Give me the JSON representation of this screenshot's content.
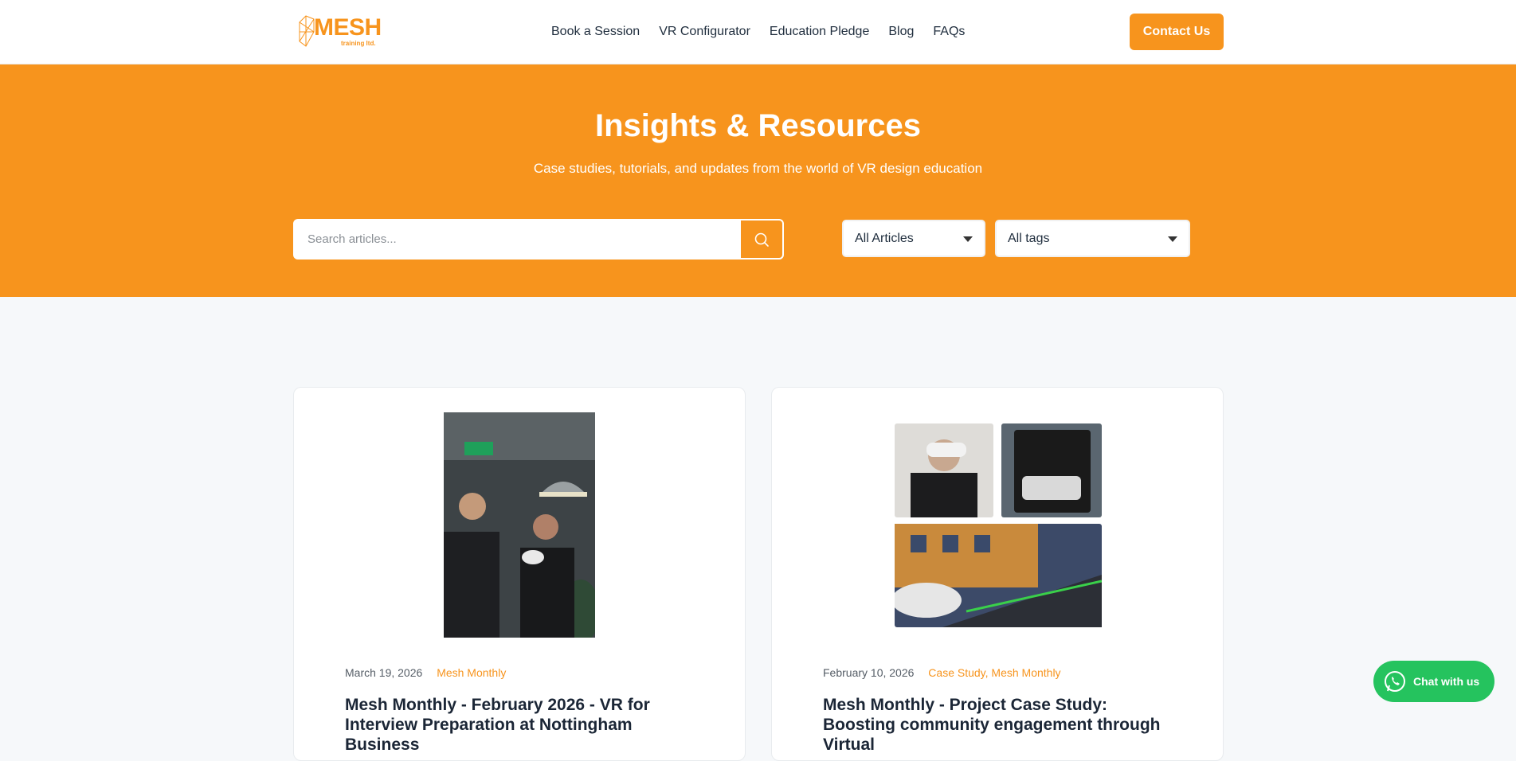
{
  "brand": {
    "name": "MESH",
    "subtitle": "training ltd.",
    "accent": "#f7941d"
  },
  "nav": {
    "items": [
      {
        "label": "Book a Session"
      },
      {
        "label": "VR Configurator"
      },
      {
        "label": "Education Pledge"
      },
      {
        "label": "Blog"
      },
      {
        "label": "FAQs"
      }
    ],
    "cta_label": "Contact Us"
  },
  "hero": {
    "title": "Insights & Resources",
    "subtitle": "Case studies, tutorials, and updates from the world of VR design education",
    "search_placeholder": "Search articles...",
    "filter_type": "All Articles",
    "filter_tags": "All tags"
  },
  "posts": [
    {
      "date": "March 19, 2026",
      "categories": "Mesh Monthly",
      "title": "Mesh Monthly - February 2026 - VR for Interview Preparation at Nottingham Business"
    },
    {
      "date": "February 10, 2026",
      "categories": "Case Study, Mesh Monthly",
      "title": "Mesh Monthly - Project Case Study: Boosting community engagement through Virtual"
    }
  ],
  "chat": {
    "label": "Chat with us",
    "color": "#25c35e"
  }
}
